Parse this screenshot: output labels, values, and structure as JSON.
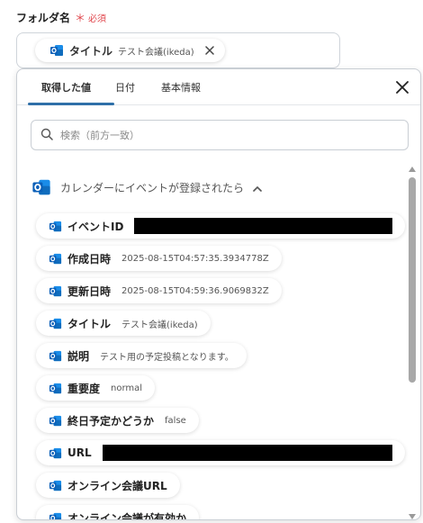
{
  "field": {
    "label": "フォルダ名",
    "required_star": "＊",
    "required_label": "必須",
    "token_name": "タイトル",
    "token_value": "テスト会議(ikeda)"
  },
  "tabs": [
    {
      "label": "取得した値"
    },
    {
      "label": "日付"
    },
    {
      "label": "基本情報"
    }
  ],
  "search": {
    "placeholder": "検索（前方一致）",
    "value": ""
  },
  "group": {
    "title": "カレンダーにイベントが登録されたら"
  },
  "items": [
    {
      "label": "イベントID",
      "value": "",
      "redacted": true
    },
    {
      "label": "作成日時",
      "value": "2025-08-15T04:57:35.3934778Z"
    },
    {
      "label": "更新日時",
      "value": "2025-08-15T04:59:36.9069832Z"
    },
    {
      "label": "タイトル",
      "value": "テスト会議(ikeda)"
    },
    {
      "label": "説明",
      "value": "テスト用の予定投稿となります。"
    },
    {
      "label": "重要度",
      "value": "normal"
    },
    {
      "label": "終日予定かどうか",
      "value": "false"
    },
    {
      "label": "URL",
      "value": "",
      "redacted": true
    },
    {
      "label": "オンライン会議URL",
      "value": ""
    },
    {
      "label": "オンライン会議が有効か",
      "value": ""
    }
  ],
  "colors": {
    "tab_active": "#2e6fa8",
    "required": "#e0464c",
    "outlook_blue": "#0a64c8"
  },
  "icons": {
    "app": "outlook-icon",
    "search": "search-icon",
    "close": "close-icon",
    "collapse": "chevron-up-icon"
  }
}
